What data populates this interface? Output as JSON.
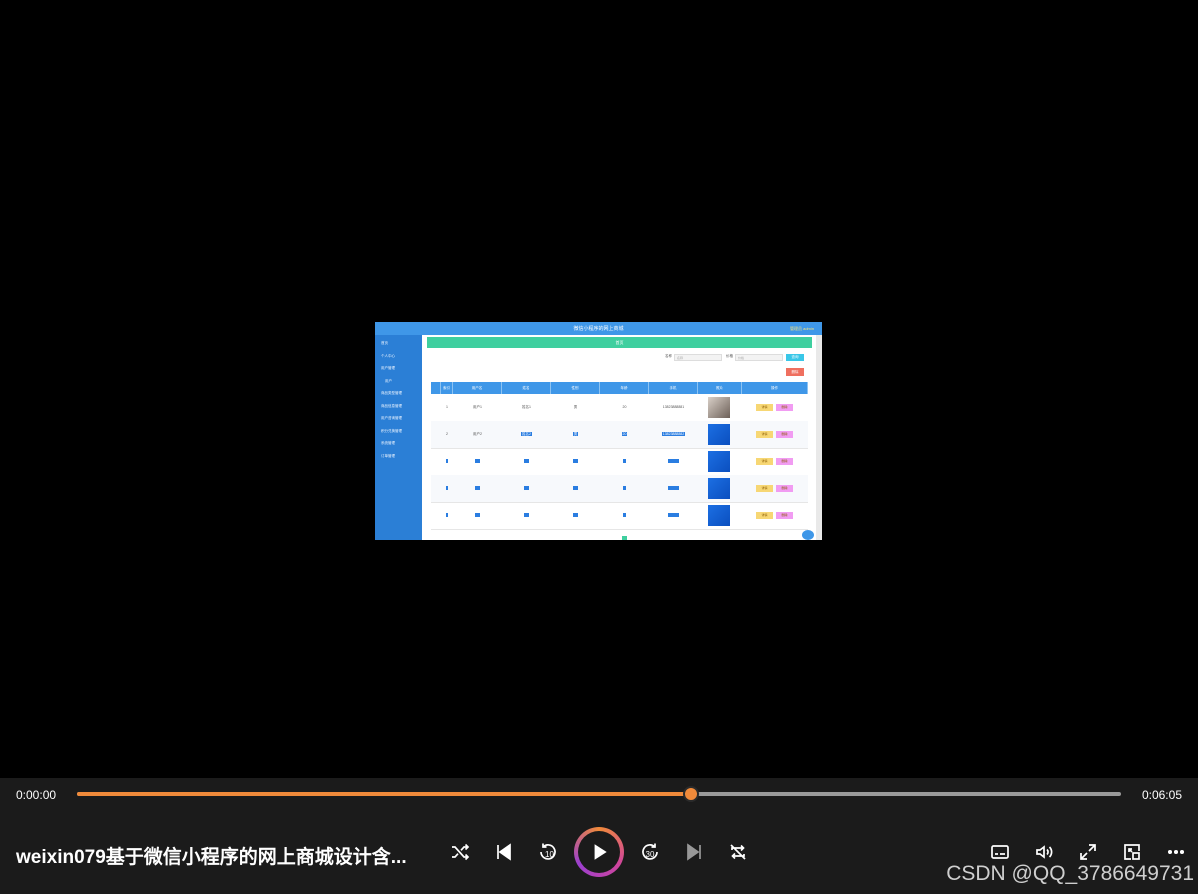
{
  "video_frame": {
    "app_title": "微信小程序的网上商城",
    "user_label": "管理员 admin",
    "banner": "首页",
    "search": {
      "label1": "名称",
      "placeholder1": "名称",
      "label2": "价格",
      "placeholder2": "价格",
      "button": "查询"
    },
    "delete_button": "删除",
    "sidebar_items": [
      "首页",
      "个人中心",
      "用户管理",
      "用户",
      "商品类型管理",
      "商品信息管理",
      "用户咨询管理",
      "积分兑换管理",
      "系统管理",
      "订单管理"
    ],
    "table_headers": [
      "索引",
      "用户名",
      "姓名",
      "性别",
      "年龄",
      "手机",
      "照片",
      "操作"
    ],
    "row1": {
      "index": "1",
      "username": "用户1",
      "name": "姓名1",
      "gender": "男",
      "age": "20",
      "phone": "13823888881"
    },
    "row2": {
      "index": "2",
      "username": "用户2",
      "name": "姓名2",
      "gender": "男",
      "age": "20",
      "phone": "13823888882"
    },
    "action_view": "详情",
    "action_delete": "删除"
  },
  "player": {
    "current_time": "0:00:00",
    "total_time": "0:06:05",
    "progress": 0.588,
    "title": "weixin079基于微信小程序的网上商城设计含...",
    "skip_back_seconds": "10",
    "skip_forward_seconds": "30",
    "accent_color": "#f08a3a"
  },
  "watermark": "CSDN @QQ_3786649731"
}
